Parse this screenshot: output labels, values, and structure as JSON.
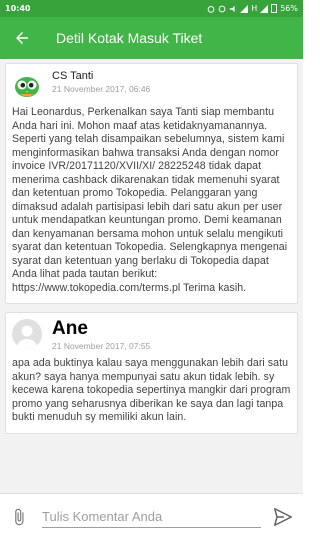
{
  "status_bar": {
    "time": "10:40",
    "network": "H",
    "battery": "56%"
  },
  "header": {
    "title": "Detil Kotak Masuk Tiket"
  },
  "messages": [
    {
      "sender": "CS Tanti",
      "timestamp": "21 November 2017, 06:46",
      "avatar": "cs-avatar-icon",
      "body": "Hai Leonardus, Perkenalkan saya Tanti siap membantu Anda hari ini. Mohon maaf atas ketidaknyamanannya. Seperti yang telah disampaikan sebelumnya, sistem kami menginformasikan bahwa transaksi Anda dengan nomor invoice IVR/20171120/XVII/XI/ 28225248 tidak dapat menerima cashback dikarenakan tidak memenuhi syarat dan ketentuan promo Tokopedia. Pelanggaran yang dimaksud adalah partisipasi lebih dari satu akun per user untuk mendapatkan keuntungan promo. Demi keamanan dan kenyamanan bersama mohon untuk selalu mengikuti syarat dan ketentuan Tokopedia. Selengkapnya mengenai syarat dan ketentuan yang berlaku di Tokopedia dapat Anda lihat pada tautan berikut: https://www.tokopedia.com/terms.pl Terima kasih."
    },
    {
      "sender": "Ane",
      "timestamp": "21 November 2017, 07:55",
      "avatar": "default-user-avatar-icon",
      "body": "apa ada buktinya kalau saya menggunakan lebih dari satu akun? saya hanya mempunyai satu akun tidak lebih. sy kecewa karena tokopedia sepertinya mangkir dari program promo yang seharusnya diberikan ke saya dan lagi tanpa bukti menuduh sy memiliki akun lain."
    }
  ],
  "composer": {
    "placeholder": "Tulis Komentar Anda"
  },
  "colors": {
    "status_bar": "#37a33a",
    "app_bar": "#42b549",
    "background": "#f2f2f2"
  }
}
